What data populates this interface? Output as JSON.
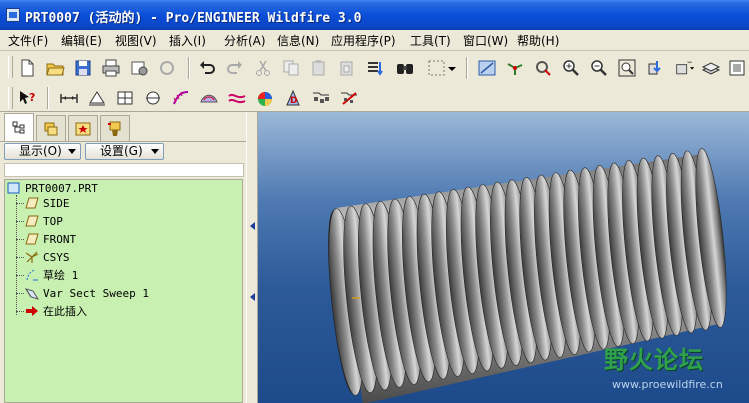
{
  "window": {
    "title": "PRT0007 (活动的) - Pro/ENGINEER Wildfire 3.0"
  },
  "menu": [
    {
      "label": "文件(F)"
    },
    {
      "label": "编辑(E)"
    },
    {
      "label": "视图(V)"
    },
    {
      "label": "插入(I)"
    },
    {
      "label": "分析(A)"
    },
    {
      "label": "信息(N)"
    },
    {
      "label": "应用程序(P)"
    },
    {
      "label": "工具(T)"
    },
    {
      "label": "窗口(W)"
    },
    {
      "label": "帮助(H)"
    }
  ],
  "navigator": {
    "tabs": [
      {
        "name": "model-tree"
      },
      {
        "name": "folder-browser"
      },
      {
        "name": "favorites"
      },
      {
        "name": "connections"
      }
    ],
    "show_button": "显示(O)",
    "settings_button": "设置(G)"
  },
  "model_tree": {
    "root": "PRT0007.PRT",
    "items": [
      {
        "label": "SIDE",
        "icon": "datum-plane-icon"
      },
      {
        "label": "TOP",
        "icon": "datum-plane-icon"
      },
      {
        "label": "FRONT",
        "icon": "datum-plane-icon"
      },
      {
        "label": "CSYS",
        "icon": "coordinate-system-icon"
      },
      {
        "label": "草绘 1",
        "icon": "sketch-icon"
      },
      {
        "label": "Var Sect Sweep 1",
        "icon": "sweep-icon"
      },
      {
        "label": "在此插入",
        "icon": "insert-here-arrow-icon"
      }
    ]
  },
  "watermark": {
    "text": "野火论坛",
    "url": "www.proewildfire.cn"
  },
  "colors": {
    "titlebar": "#0a4fd8",
    "tree_background": "#c7f0b1",
    "viewport": "#2d5a99",
    "accent_red": "#cc0000"
  }
}
